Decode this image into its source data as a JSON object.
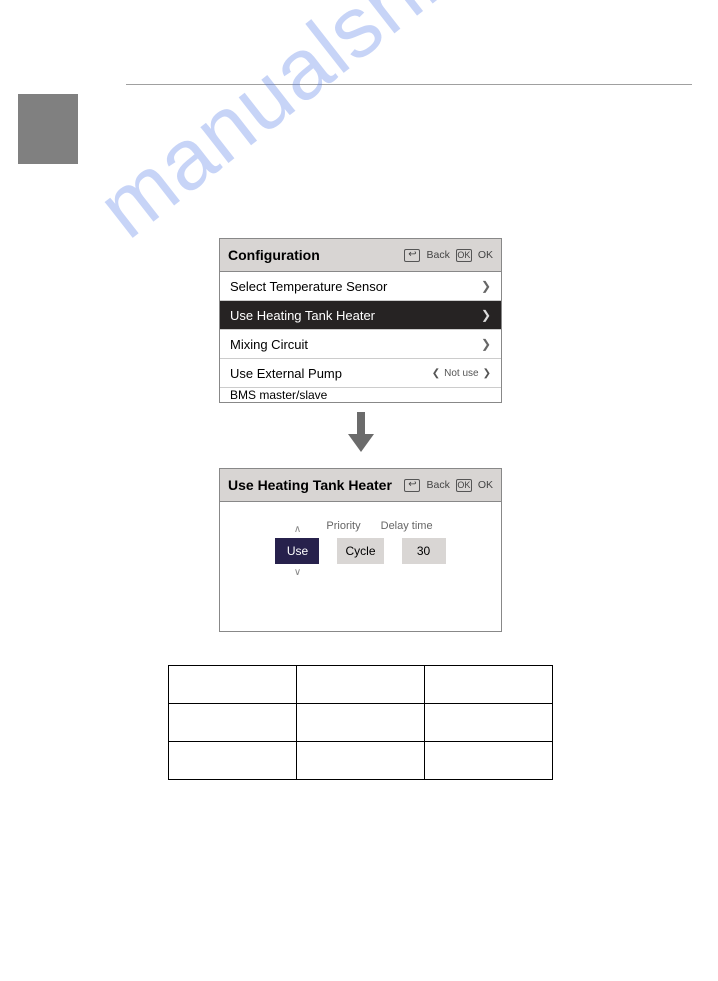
{
  "watermark": "manualshive.com",
  "screen1": {
    "title": "Configuration",
    "back": "Back",
    "ok": "OK",
    "ok_icon": "OK",
    "items": [
      {
        "label": "Select Temperature Sensor",
        "selected": false
      },
      {
        "label": "Use Heating Tank Heater",
        "selected": true
      },
      {
        "label": "Mixing Circuit",
        "selected": false
      }
    ],
    "ext_pump_label": "Use External Pump",
    "ext_pump_value": "Not use",
    "last_partial": "BMS master/slave"
  },
  "screen2": {
    "title": "Use Heating Tank Heater",
    "back": "Back",
    "ok": "OK",
    "ok_icon": "OK",
    "label_priority": "Priority",
    "label_delay": "Delay time",
    "use_value": "Use",
    "priority_value": "Cycle",
    "delay_value": "30"
  }
}
